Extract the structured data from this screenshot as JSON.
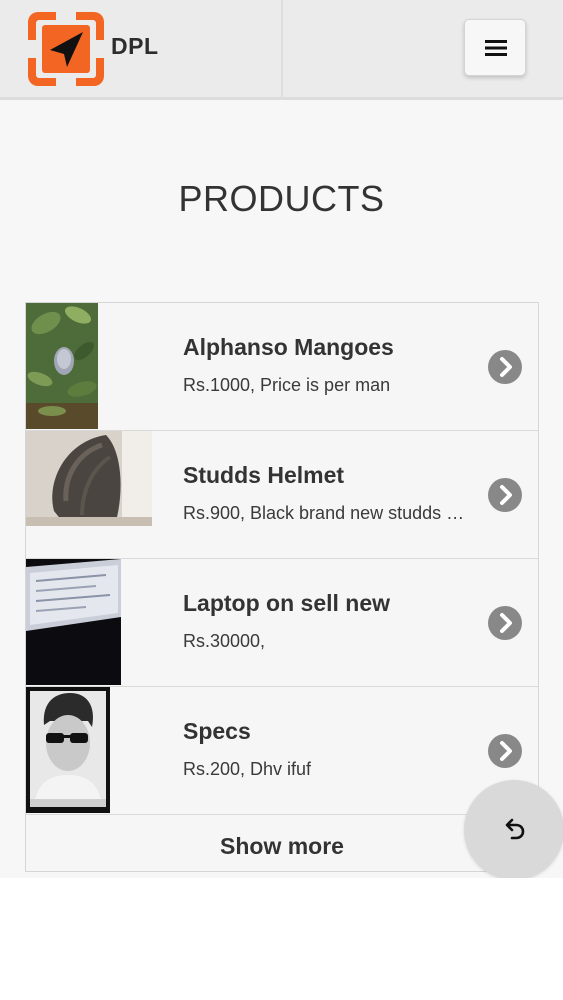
{
  "header": {
    "brand": "DPL",
    "logo_icon": "navigation-arrow-logo-icon",
    "menu_icon": "hamburger-menu-icon",
    "accent_color": "#f26522"
  },
  "page": {
    "title": "PRODUCTS"
  },
  "products": [
    {
      "title": "Alphanso Mangoes",
      "subtitle": "Rs.1000, Price is per man",
      "image": "mango-plant-photo"
    },
    {
      "title": "Studds Helmet",
      "subtitle": "Rs.900, Black brand new studds …",
      "image": "helmet-photo"
    },
    {
      "title": "Laptop on sell new",
      "subtitle": "Rs.30000,",
      "image": "laptop-screen-photo"
    },
    {
      "title": "Specs",
      "subtitle": "Rs.200, Dhv ifuf",
      "image": "man-with-sunglasses-photo"
    }
  ],
  "list": {
    "show_more_label": "Show more",
    "chevron_icon": "chevron-right-circle-icon"
  },
  "fab": {
    "icon": "undo-icon"
  }
}
